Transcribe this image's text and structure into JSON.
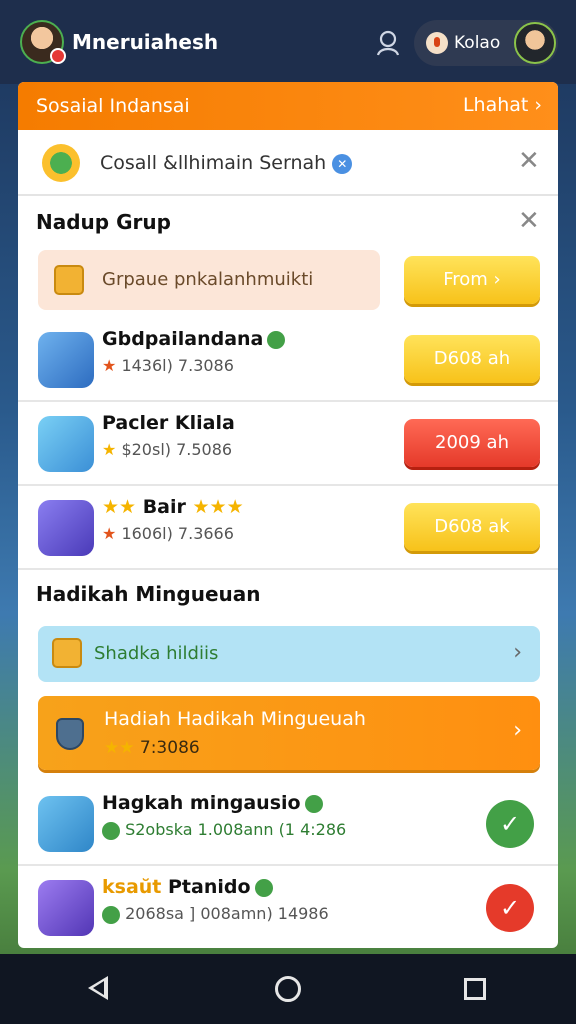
{
  "header": {
    "username": "Mneruiahesh",
    "profile_label": "Kolao"
  },
  "card": {
    "title": "Sosaial Indansai",
    "see_label": "Lhahat ›"
  },
  "search": {
    "text": "Cosall &llhimain Sernah"
  },
  "group": {
    "title": "Nadup Grup",
    "promo_text": "Grpaue pnkalanhmuikti",
    "promo_button": "From ›",
    "items": [
      {
        "name": "Gbdpailandana",
        "sub": "1436l) 7.3086",
        "button": "D608 ah",
        "button_color": "yellow"
      },
      {
        "name": "Pacler Kliala",
        "sub": "$20sl) 7.5086",
        "button": "2009 ah",
        "button_color": "red"
      },
      {
        "name": "Bair",
        "sub": "1606l) 7.3666",
        "button": "D608 ak",
        "button_color": "yellow"
      }
    ]
  },
  "rewards": {
    "title": "Hadikah Mingueuan",
    "blue_bar_text": "Shadka hildiis",
    "banner_title": "Hadiah Hadikah Mingueuah",
    "banner_sub": "7:3086",
    "items": [
      {
        "name": "Hagkah mingausio",
        "sub": "S2obska 1.008ann (1 4:286",
        "status": "check-green"
      },
      {
        "name": "Ptanido",
        "prefix": "ksaŭt",
        "sub": "2068sa ] 008amn) 14986",
        "status": "check-red"
      }
    ]
  },
  "colors": {
    "accent": "#f57c00",
    "green": "#43a047",
    "red": "#e53a2a",
    "yellow": "#f7c21a"
  }
}
